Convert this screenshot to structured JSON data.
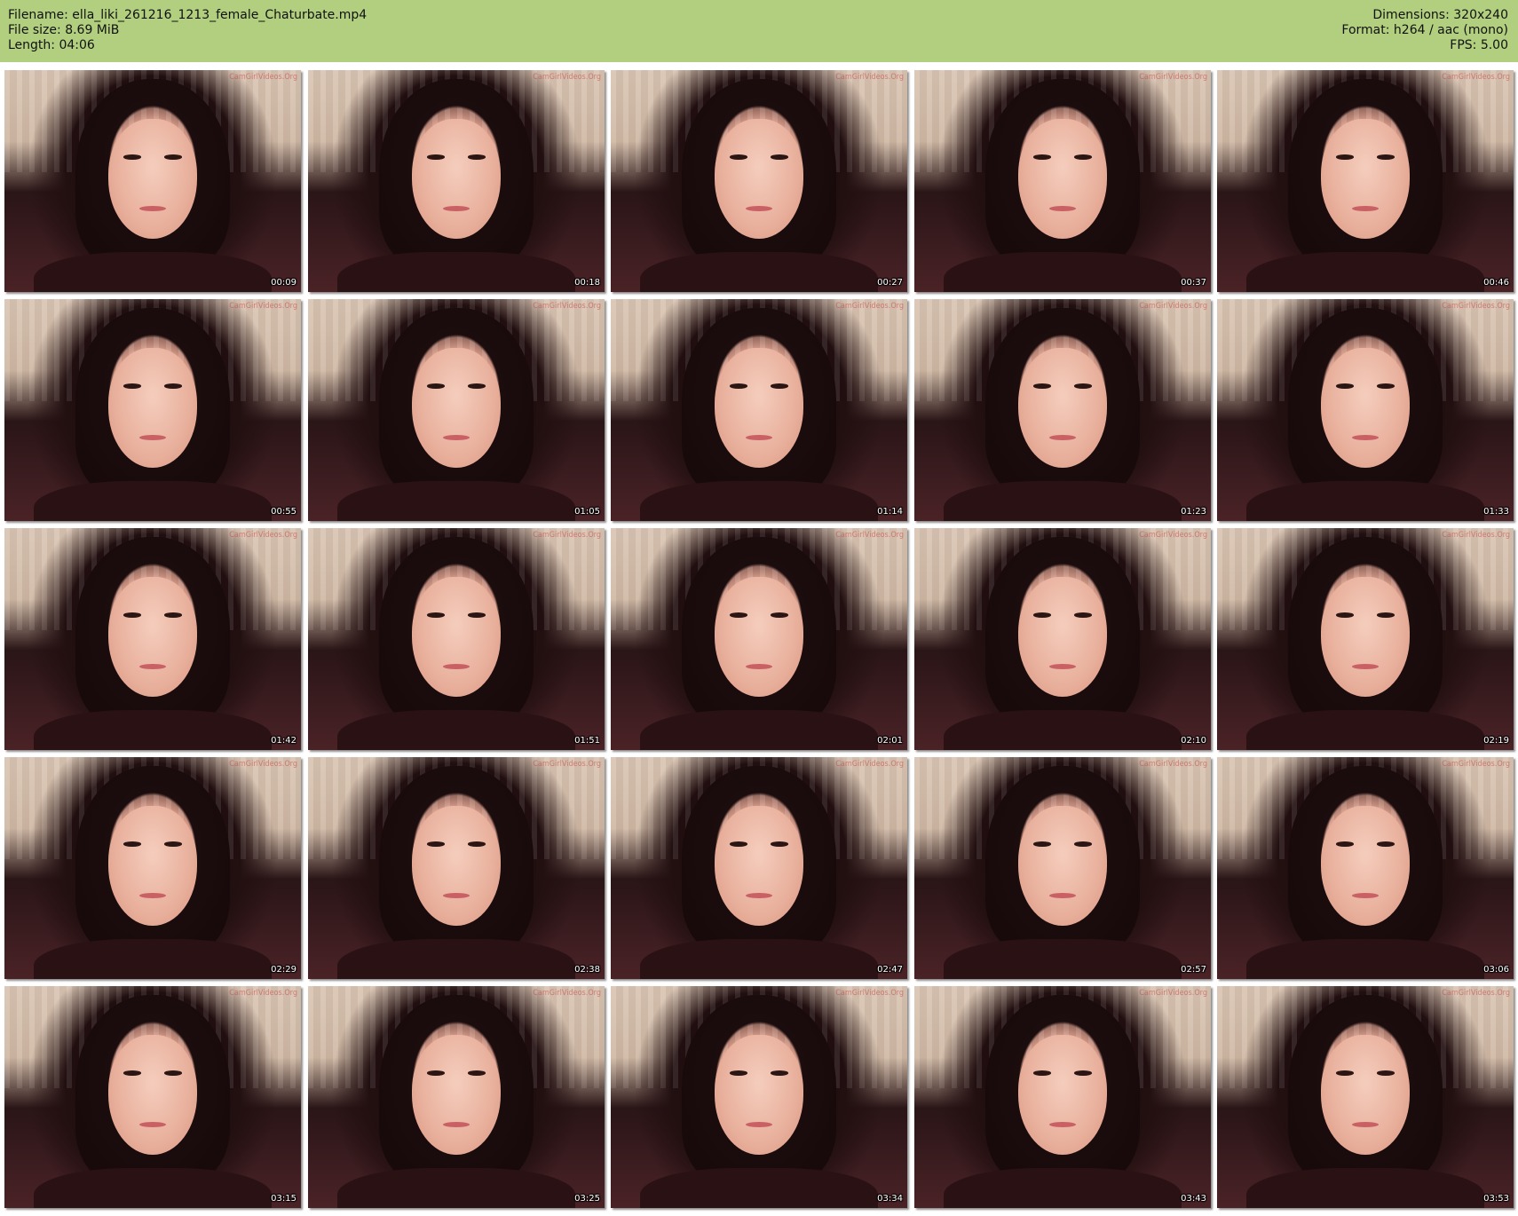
{
  "header": {
    "filename_line": "Filename: ella_liki_261216_1213_female_Chaturbate.mp4",
    "filesize_line": "File size: 8.69 MiB",
    "length_line": "Length: 04:06",
    "dimensions_line": "Dimensions: 320x240",
    "format_line": "Format: h264 / aac (mono)",
    "fps_line": "FPS: 5.00",
    "background_color": "#b1cf7f"
  },
  "watermark_text": "CamGirlVideos.Org",
  "thumbnails": [
    {
      "timestamp": "00:09"
    },
    {
      "timestamp": "00:18"
    },
    {
      "timestamp": "00:27"
    },
    {
      "timestamp": "00:37"
    },
    {
      "timestamp": "00:46"
    },
    {
      "timestamp": "00:55"
    },
    {
      "timestamp": "01:05"
    },
    {
      "timestamp": "01:14"
    },
    {
      "timestamp": "01:23"
    },
    {
      "timestamp": "01:33"
    },
    {
      "timestamp": "01:42"
    },
    {
      "timestamp": "01:51"
    },
    {
      "timestamp": "02:01"
    },
    {
      "timestamp": "02:10"
    },
    {
      "timestamp": "02:19"
    },
    {
      "timestamp": "02:29"
    },
    {
      "timestamp": "02:38"
    },
    {
      "timestamp": "02:47"
    },
    {
      "timestamp": "02:57"
    },
    {
      "timestamp": "03:06"
    },
    {
      "timestamp": "03:15"
    },
    {
      "timestamp": "03:25"
    },
    {
      "timestamp": "03:34"
    },
    {
      "timestamp": "03:43"
    },
    {
      "timestamp": "03:53"
    }
  ]
}
